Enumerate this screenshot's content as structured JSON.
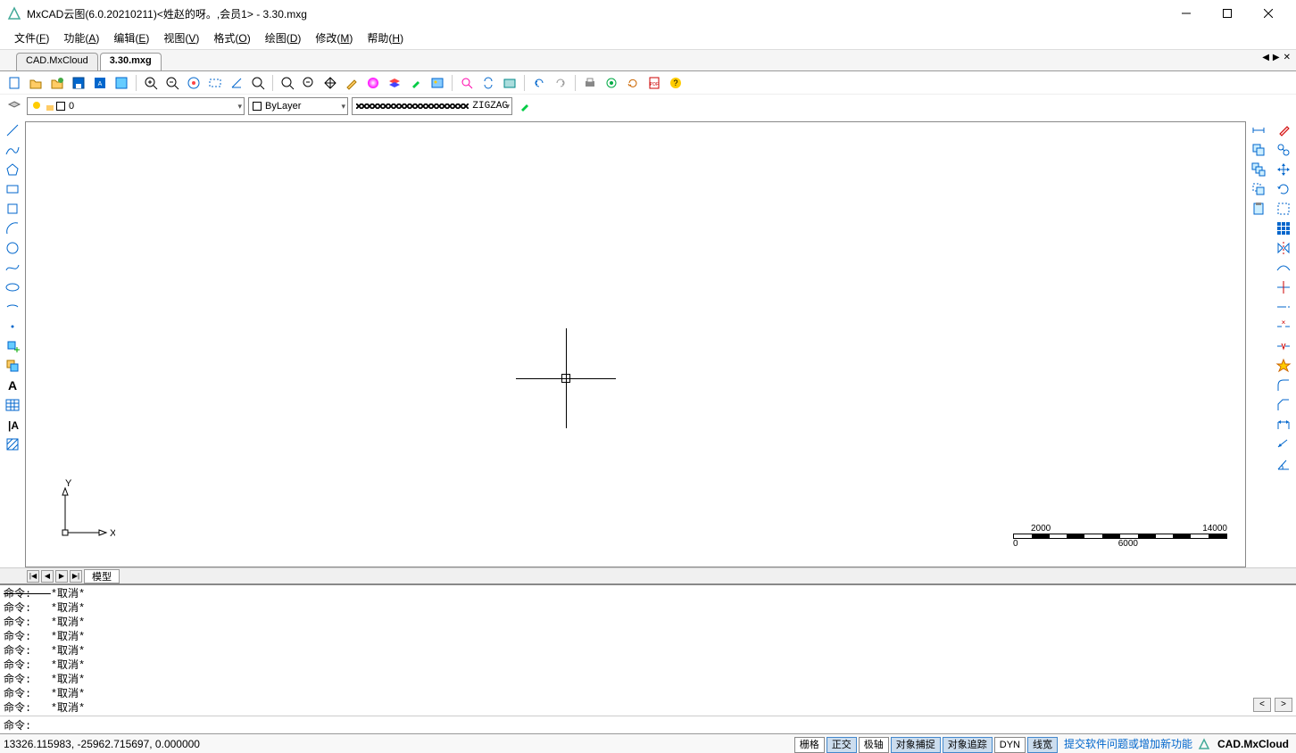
{
  "title": "MxCAD云图(6.0.20210211)<姓赵的呀。,会员1> - 3.30.mxg",
  "menus": [
    {
      "label": "文件",
      "key": "F"
    },
    {
      "label": "功能",
      "key": "A"
    },
    {
      "label": "编辑",
      "key": "E"
    },
    {
      "label": "视图",
      "key": "V"
    },
    {
      "label": "格式",
      "key": "O"
    },
    {
      "label": "绘图",
      "key": "D"
    },
    {
      "label": "修改",
      "key": "M"
    },
    {
      "label": "帮助",
      "key": "H"
    }
  ],
  "tabs": [
    {
      "label": "CAD.MxCloud",
      "active": false
    },
    {
      "label": "3.30.mxg",
      "active": true
    }
  ],
  "layer_dd": {
    "value": "0"
  },
  "color_dd": {
    "value": "ByLayer"
  },
  "linetype_dd": {
    "value": "ZIGZAG"
  },
  "modeltab": "模型",
  "scalebar": {
    "top_left": "2000",
    "top_right": "14000",
    "bot_left": "0",
    "bot_right": "6000"
  },
  "ucs": {
    "x": "X",
    "y": "Y"
  },
  "cmdlog": {
    "lines": [
      {
        "prefix": "命令:",
        "text": "*取消*",
        "struck": true
      },
      {
        "prefix": "命令:",
        "text": "*取消*"
      },
      {
        "prefix": "命令:",
        "text": "*取消*"
      },
      {
        "prefix": "命令:",
        "text": "*取消*"
      },
      {
        "prefix": "命令:",
        "text": "*取消*"
      },
      {
        "prefix": "命令:",
        "text": "*取消*"
      },
      {
        "prefix": "命令:",
        "text": "*取消*"
      },
      {
        "prefix": "命令:",
        "text": "*取消*"
      },
      {
        "prefix": "命令:",
        "text": "*取消*"
      }
    ]
  },
  "cmdprompt": "命令:",
  "coords": "13326.115983,  -25962.715697,  0.000000",
  "status_buttons": [
    {
      "label": "栅格",
      "active": false
    },
    {
      "label": "正交",
      "active": true
    },
    {
      "label": "极轴",
      "active": false
    },
    {
      "label": "对象捕捉",
      "active": true
    },
    {
      "label": "对象追踪",
      "active": true
    },
    {
      "label": "DYN",
      "active": false
    },
    {
      "label": "线宽",
      "active": true
    }
  ],
  "feedback_link": "提交软件问题或增加新功能",
  "brand": "CAD.MxCloud"
}
